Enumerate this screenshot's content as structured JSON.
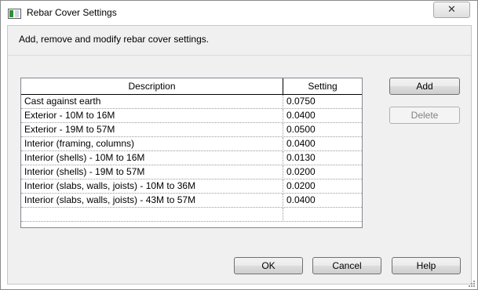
{
  "window": {
    "title": "Rebar Cover Settings",
    "close_label": "✕"
  },
  "instructions": "Add, remove and modify rebar cover settings.",
  "table": {
    "columns": [
      "Description",
      "Setting"
    ],
    "rows": [
      {
        "description": "Cast against earth",
        "setting": "0.0750"
      },
      {
        "description": "Exterior - 10M to 16M",
        "setting": "0.0400"
      },
      {
        "description": "Exterior - 19M to 57M",
        "setting": "0.0500"
      },
      {
        "description": "Interior (framing, columns)",
        "setting": "0.0400"
      },
      {
        "description": "Interior (shells) - 10M to 16M",
        "setting": "0.0130"
      },
      {
        "description": "Interior (shells) - 19M to 57M",
        "setting": "0.0200"
      },
      {
        "description": "Interior (slabs, walls, joists) - 10M to 36M",
        "setting": "0.0200"
      },
      {
        "description": "Interior (slabs, walls, joists) - 43M to 57M",
        "setting": "0.0400"
      },
      {
        "description": "",
        "setting": ""
      }
    ]
  },
  "buttons": {
    "add": "Add",
    "delete": "Delete",
    "ok": "OK",
    "cancel": "Cancel",
    "help": "Help"
  }
}
